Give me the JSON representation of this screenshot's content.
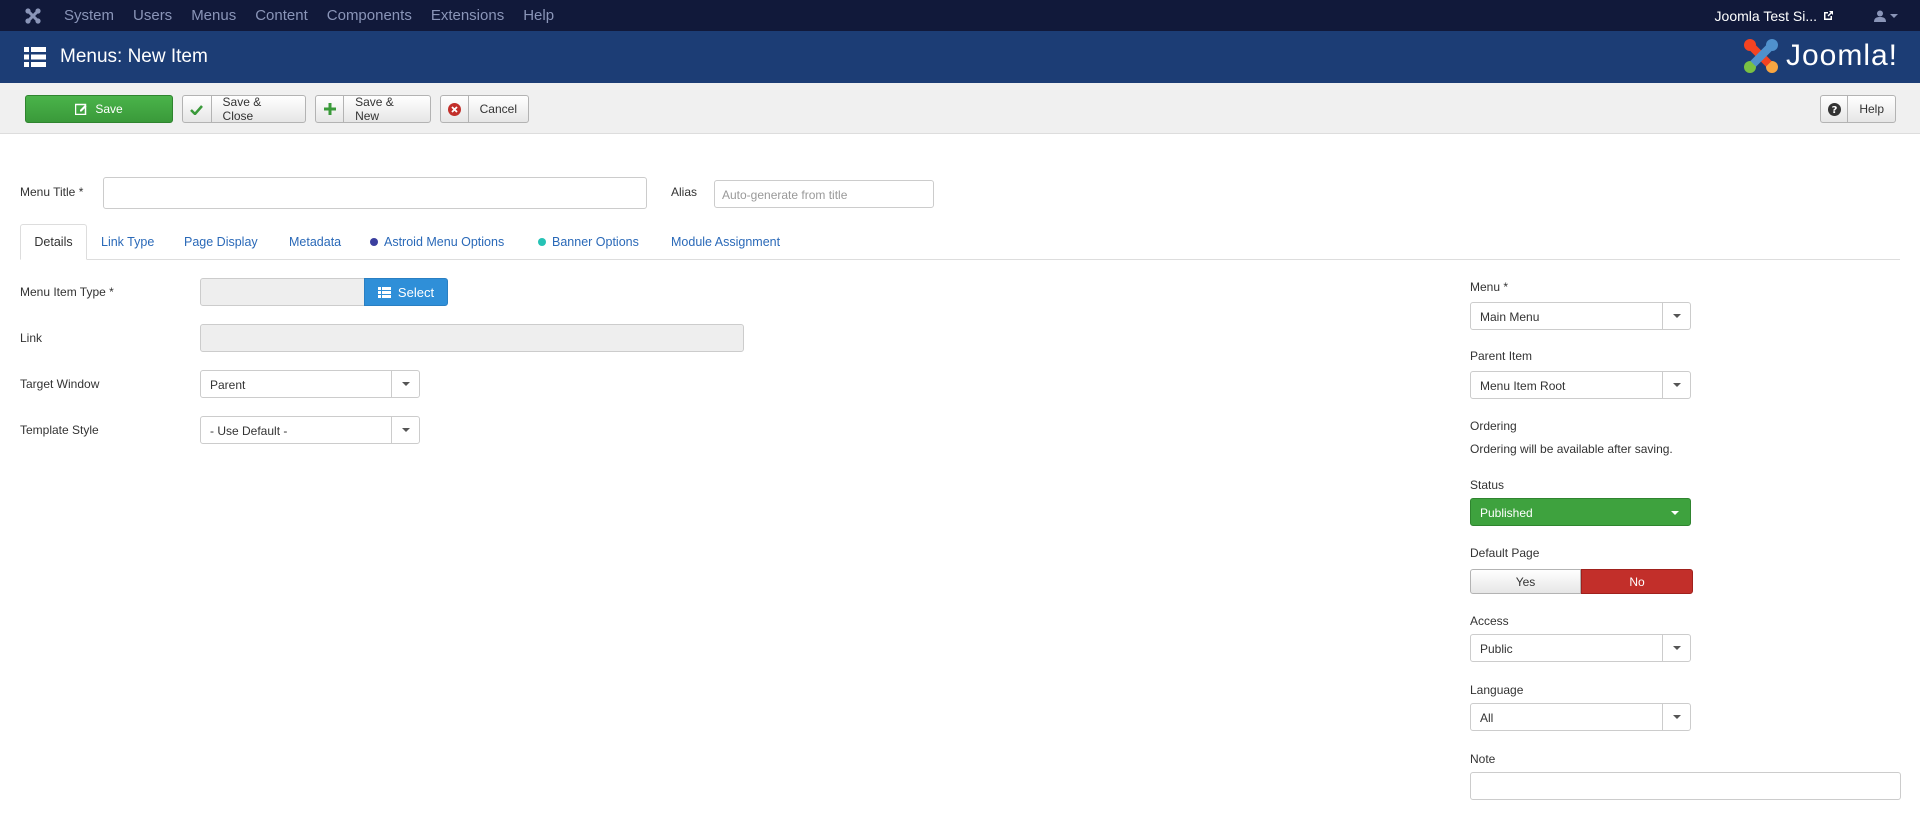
{
  "topnav": {
    "items": [
      "System",
      "Users",
      "Menus",
      "Content",
      "Components",
      "Extensions",
      "Help"
    ],
    "site_link": "Joomla Test Si..."
  },
  "header": {
    "title": "Menus: New Item",
    "logo_text": "Joomla!"
  },
  "toolbar": {
    "save": "Save",
    "save_close": "Save & Close",
    "save_new": "Save & New",
    "cancel": "Cancel",
    "help": "Help"
  },
  "form": {
    "menu_title_label": "Menu Title *",
    "menu_title_value": "",
    "alias_label": "Alias",
    "alias_placeholder": "Auto-generate from title"
  },
  "tabs": [
    {
      "label": "Details"
    },
    {
      "label": "Link Type"
    },
    {
      "label": "Page Display"
    },
    {
      "label": "Metadata"
    },
    {
      "label": "Astroid Menu Options"
    },
    {
      "label": "Banner Options"
    },
    {
      "label": "Module Assignment"
    }
  ],
  "details": {
    "menu_item_type_label": "Menu Item Type *",
    "select_button": "Select",
    "link_label": "Link",
    "target_window_label": "Target Window",
    "target_window_value": "Parent",
    "template_style_label": "Template Style",
    "template_style_value": "- Use Default -"
  },
  "sidebar": {
    "menu_label": "Menu *",
    "menu_value": "Main Menu",
    "parent_item_label": "Parent Item",
    "parent_item_value": "Menu Item Root",
    "ordering_label": "Ordering",
    "ordering_text": "Ordering will be available after saving.",
    "status_label": "Status",
    "status_value": "Published",
    "default_page_label": "Default Page",
    "default_yes": "Yes",
    "default_no": "No",
    "access_label": "Access",
    "access_value": "Public",
    "language_label": "Language",
    "language_value": "All",
    "note_label": "Note",
    "note_value": ""
  },
  "colors": {
    "topnav_bg": "#11193a",
    "header_bg": "#1c3d75",
    "save_green": "#3ea23e",
    "select_blue": "#2f8fd8",
    "no_red": "#c22f2a",
    "link_blue": "#2a69b8"
  },
  "icons": {
    "topnav_logo": "joomla-logo-icon",
    "title": "list-icon",
    "save": "edit-icon",
    "save_close": "check-icon",
    "save_new": "plus-icon",
    "cancel": "cancel-icon",
    "help": "question-icon",
    "user": "user-icon",
    "external": "external-link-icon"
  }
}
